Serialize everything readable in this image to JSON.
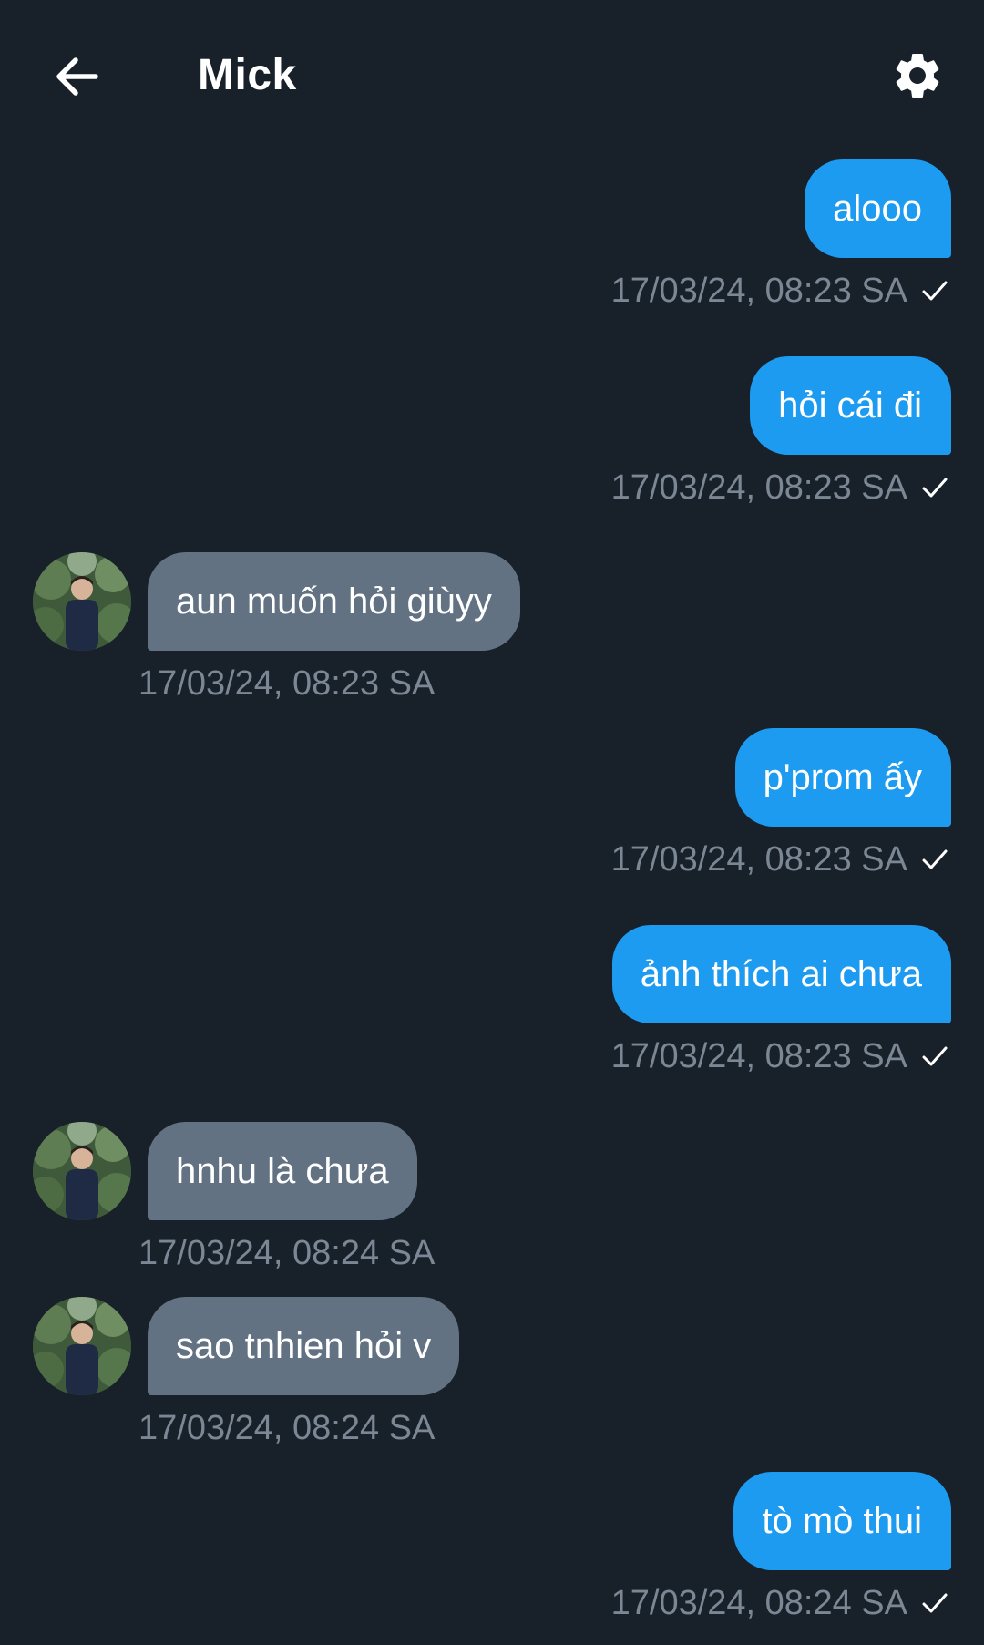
{
  "header": {
    "title": "Mick",
    "back_icon": "arrow-left-icon",
    "settings_icon": "gear-icon"
  },
  "colors": {
    "background": "#18202a",
    "outgoing_bubble": "#1d9bf0",
    "incoming_bubble": "#627283",
    "timestamp": "#7b8794"
  },
  "messages": [
    {
      "direction": "out",
      "text": "alooo",
      "time": "17/03/24, 08:23 SA",
      "status_icon": "check-icon"
    },
    {
      "direction": "out",
      "text": "hỏi cái đi",
      "time": "17/03/24, 08:23 SA",
      "status_icon": "check-icon"
    },
    {
      "direction": "in",
      "text": "aun muốn hỏi giùyy",
      "time": "17/03/24, 08:23 SA",
      "avatar": "avatar"
    },
    {
      "direction": "out",
      "text": "p'prom ấy",
      "time": "17/03/24, 08:23 SA",
      "status_icon": "check-icon"
    },
    {
      "direction": "out",
      "text": "ảnh thích ai chưa",
      "time": "17/03/24, 08:23 SA",
      "status_icon": "check-icon"
    },
    {
      "direction": "in",
      "text": "hnhu là chưa",
      "time": "17/03/24, 08:24 SA",
      "avatar": "avatar"
    },
    {
      "direction": "in",
      "text": "sao tnhien hỏi v",
      "time": "17/03/24, 08:24 SA",
      "avatar": "avatar"
    },
    {
      "direction": "out",
      "text": "tò mò thui",
      "time": "17/03/24, 08:24 SA",
      "status_icon": "check-icon"
    }
  ]
}
